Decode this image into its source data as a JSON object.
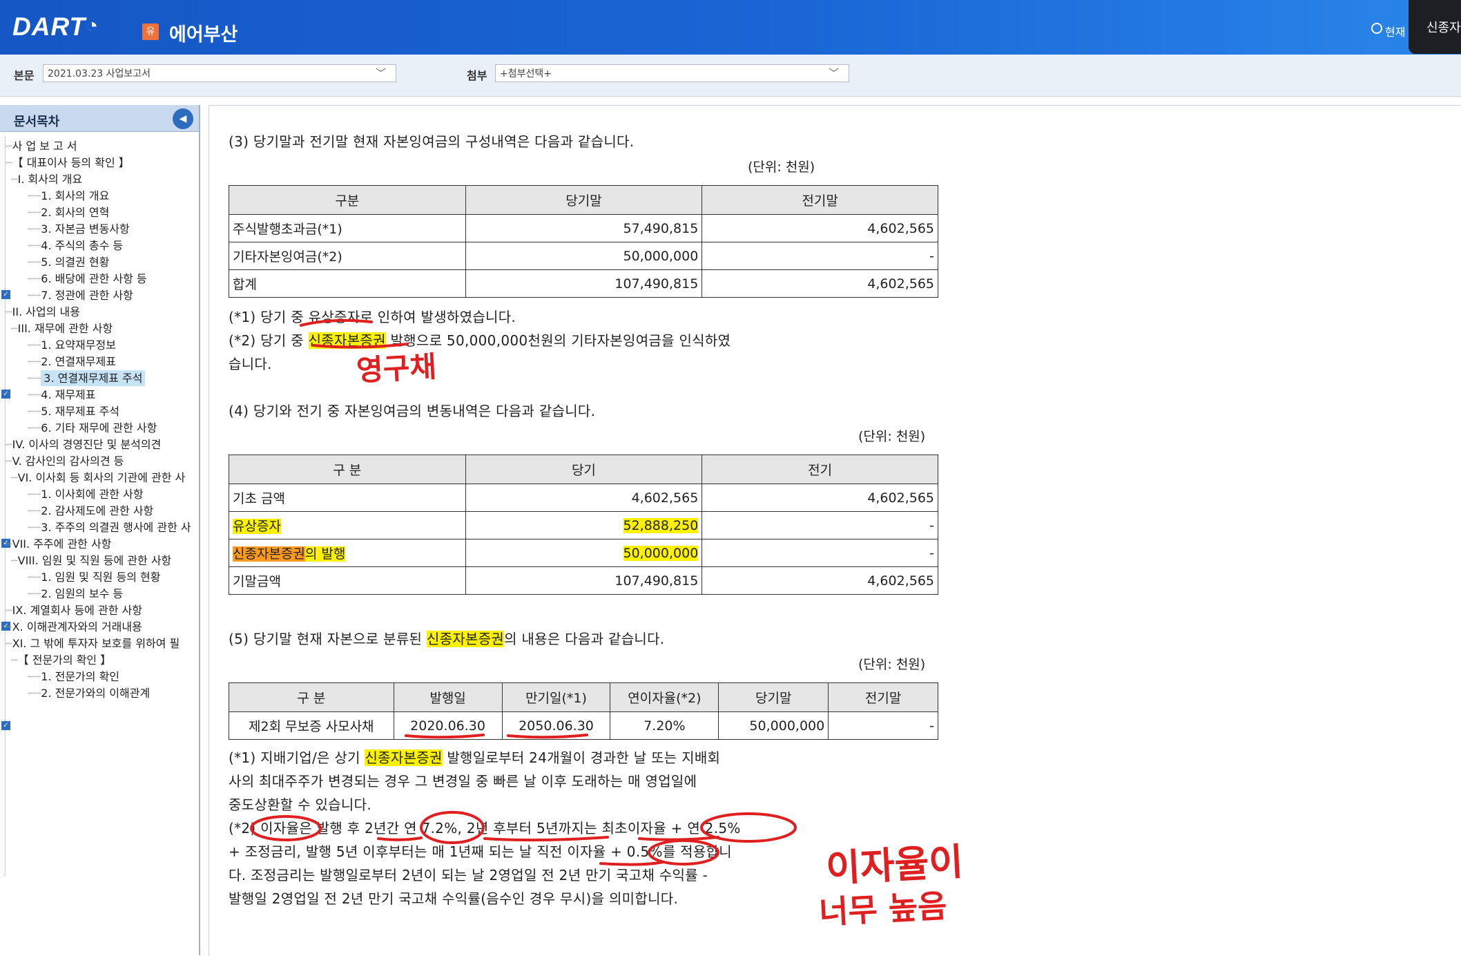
{
  "header": {
    "logo": "DART",
    "company_badge": "유",
    "company_name": "에어부산",
    "current_label": "현재",
    "black_tab_label": "신종자"
  },
  "selector": {
    "body_label": "본문",
    "body_value": "2021.03.23  사업보고서",
    "attach_label": "첨부",
    "attach_value": "+첨부선택+"
  },
  "toc": {
    "title": "문서목차",
    "items": [
      "사 업 보 고 서",
      "【 대표이사 등의 확인 】",
      "I. 회사의 개요",
      "1. 회사의 개요",
      "2. 회사의 연혁",
      "3. 자본금 변동사항",
      "4. 주식의 총수 등",
      "5. 의결권 현황",
      "6. 배당에 관한 사항 등",
      "7. 정관에 관한 사항",
      "II. 사업의 내용",
      "III. 재무에 관한 사항",
      "1. 요약재무정보",
      "2. 연결재무제표",
      "3. 연결재무제표 주석",
      "4. 재무제표",
      "5. 재무제표 주석",
      "6. 기타 재무에 관한 사항",
      "IV. 이사의 경영진단 및 분석의견",
      "V. 감사인의 감사의견 등",
      "VI. 이사회 등 회사의 기관에 관한 사",
      "1. 이사회에 관한 사항",
      "2. 감사제도에 관한 사항",
      "3. 주주의 의결권 행사에 관한 사",
      "VII. 주주에 관한 사항",
      "VIII. 임원 및 직원 등에 관한 사항",
      "1. 임원 및 직원 등의 현황",
      "2. 임원의 보수 등",
      "IX. 계열회사 등에 관한 사항",
      "X. 이해관계자와의 거래내용",
      "XI. 그 밖에 투자자 보호를 위하여 필",
      "【 전문가의 확인 】",
      "1. 전문가의 확인",
      "2. 전문가와의 이해관계"
    ]
  },
  "section3": {
    "heading": "(3) 당기말과 전기말 현재 자본잉여금의 구성내역은 다음과 같습니다.",
    "unit": "(단위: 천원)",
    "headers": [
      "구분",
      "당기말",
      "전기말"
    ],
    "rows": [
      [
        "주식발행초과금(*1)",
        "57,490,815",
        "4,602,565"
      ],
      [
        "기타자본잉여금(*2)",
        "50,000,000",
        "-"
      ],
      [
        "합계",
        "107,490,815",
        "4,602,565"
      ]
    ],
    "note1_a": "(*1) 당기 중 ",
    "note1_b": "유상증자",
    "note1_c": "로 인하여 발생하였습니다.",
    "note2_a": "(*2) 당기 중 ",
    "note2_b": "신종자본증권",
    "note2_c": " 발행으로 50,000,000천원의 기타자본잉여금을 인식하였",
    "note2_d": "습니다."
  },
  "section4": {
    "heading": "(4) 당기와 전기 중 자본잉여금의 변동내역은 다음과 같습니다.",
    "unit": "(단위: 천원)",
    "headers": [
      "구 분",
      "당기",
      "전기"
    ],
    "rows": [
      [
        "기초 금액",
        "4,602,565",
        "4,602,565"
      ],
      [
        "유상증자",
        "52,888,250",
        "-"
      ],
      [
        "신종자본증권",
        "의 발행",
        "50,000,000",
        "-"
      ],
      [
        "기말금액",
        "107,490,815",
        "4,602,565"
      ]
    ]
  },
  "section5": {
    "heading_a": "(5) 당기말 현재 자본으로 분류된 ",
    "heading_b": "신종자본증권",
    "heading_c": "의 내용은 다음과 같습니다.",
    "unit": "(단위: 천원)",
    "headers": [
      "구 분",
      "발행일",
      "만기일(*1)",
      "연이자율(*2)",
      "당기말",
      "전기말"
    ],
    "row": [
      "제2회 무보증 사모사채",
      "2020.06.30",
      "2050.06.30",
      "7.20%",
      "50,000,000",
      "-"
    ],
    "note1_a": "(*1) 지배기업/은 상기 ",
    "note1_b": "신종자본증권",
    "note1_c": " 발행일로부터 24개월이 경과한 날 또는 지배회",
    "note1_line2": "사의 최대주주가 변경되는 경우 그 변경일 중 빠른 날 이후 도래하는 매 영업일에",
    "note1_line3": "중도상환할 수 있습니다.",
    "note2_line1": "(*2) 이자율은 발행 후 2년간 연 7.2%, 2년 후부터 5년까지는 최초이자율 + 연 2.5%",
    "note2_line2": "+ 조정금리, 발행 5년 이후부터는 매 1년째 되는 날 직전 이자율 + 0.5%를 적용합니",
    "note2_line3": "다. 조정금리는 발행일로부터 2년이 되는 날 2영업일 전 2년 만기 국고채 수익률 -",
    "note2_line4": "발행일 2영업일 전 2년 만기 국고채 수익률(음수인 경우 무시)을 의미합니다."
  },
  "annotations": {
    "perpetual": "영구채",
    "rate_high_1": "이자율이",
    "rate_high_2": "너무 높음"
  },
  "colors": {
    "header_blue": "#1a66d6",
    "highlight_yellow": "#fff200",
    "highlight_orange": "#ff9a1f",
    "annotation_red": "#e02020"
  }
}
